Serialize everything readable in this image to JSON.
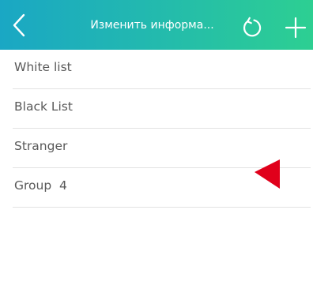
{
  "header": {
    "title": "Изменить информа...",
    "back_icon": "chevron-left-icon",
    "refresh_icon": "refresh-icon",
    "add_icon": "plus-icon",
    "gradient_start": "#1aa7c4",
    "gradient_end": "#2dcf92"
  },
  "list": {
    "items": [
      {
        "label": "White list"
      },
      {
        "label": "Black List"
      },
      {
        "label": "Stranger"
      },
      {
        "label": "Group  4"
      }
    ]
  },
  "colors": {
    "item_text": "#595959",
    "divider": "#e2e2e2",
    "pointer_marker": "#e0001b"
  }
}
